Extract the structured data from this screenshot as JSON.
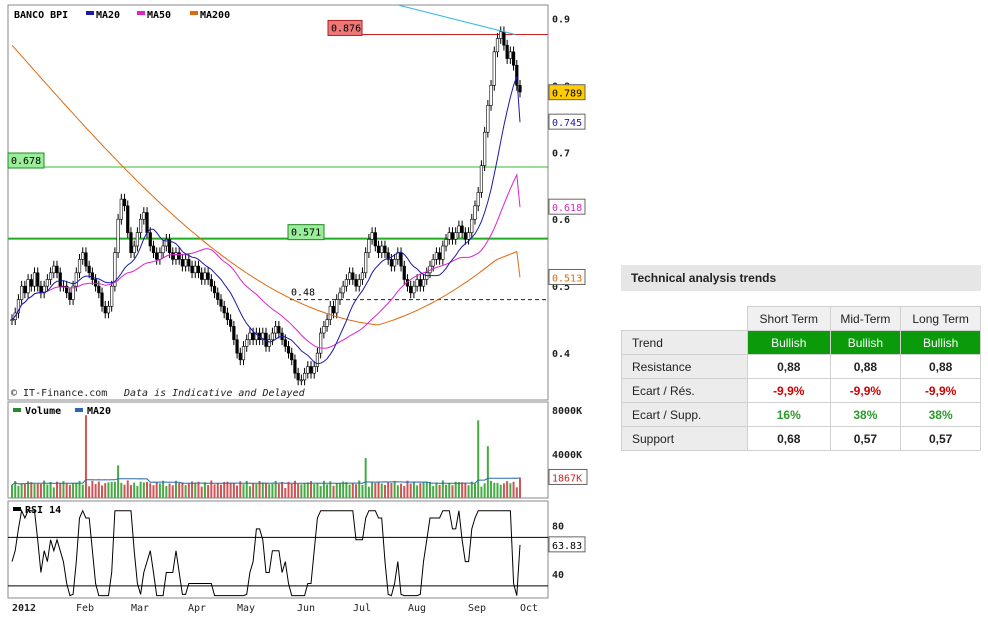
{
  "chart_data": [
    {
      "type": "candlestick",
      "title": "BANCO BPI",
      "legend": [
        {
          "name": "MA20",
          "color": "#1a1aaa"
        },
        {
          "name": "MA50",
          "color": "#dd22cc"
        },
        {
          "name": "MA200",
          "color": "#dd6a10"
        }
      ],
      "ylim": [
        0.33,
        0.92
      ],
      "y_ticks": [
        0.4,
        0.5,
        0.6,
        0.7,
        0.8,
        0.9
      ],
      "y_tick_labels": [
        "0.4",
        "0.5",
        "0.6",
        "0.7",
        "0.8",
        "0.9"
      ],
      "x_labels": [
        "2012",
        "Feb",
        "Mar",
        "Apr",
        "May",
        "Jun",
        "Jul",
        "Aug",
        "Sep",
        "Oct"
      ],
      "price_series": [
        0.45,
        0.46,
        0.48,
        0.5,
        0.49,
        0.51,
        0.5,
        0.52,
        0.5,
        0.49,
        0.5,
        0.51,
        0.52,
        0.53,
        0.52,
        0.5,
        0.5,
        0.49,
        0.48,
        0.5,
        0.52,
        0.54,
        0.55,
        0.53,
        0.52,
        0.51,
        0.5,
        0.49,
        0.47,
        0.46,
        0.47,
        0.5,
        0.55,
        0.6,
        0.63,
        0.62,
        0.58,
        0.55,
        0.56,
        0.58,
        0.6,
        0.61,
        0.58,
        0.56,
        0.55,
        0.54,
        0.55,
        0.56,
        0.57,
        0.55,
        0.54,
        0.55,
        0.54,
        0.53,
        0.54,
        0.53,
        0.52,
        0.53,
        0.52,
        0.51,
        0.52,
        0.51,
        0.5,
        0.49,
        0.48,
        0.47,
        0.46,
        0.45,
        0.44,
        0.42,
        0.4,
        0.39,
        0.41,
        0.42,
        0.43,
        0.42,
        0.43,
        0.42,
        0.43,
        0.41,
        0.42,
        0.43,
        0.44,
        0.43,
        0.42,
        0.41,
        0.4,
        0.39,
        0.37,
        0.36,
        0.36,
        0.37,
        0.38,
        0.37,
        0.38,
        0.4,
        0.43,
        0.44,
        0.45,
        0.47,
        0.46,
        0.48,
        0.49,
        0.5,
        0.51,
        0.52,
        0.51,
        0.5,
        0.51,
        0.52,
        0.55,
        0.57,
        0.58,
        0.56,
        0.55,
        0.56,
        0.55,
        0.54,
        0.53,
        0.54,
        0.55,
        0.53,
        0.51,
        0.5,
        0.49,
        0.5,
        0.51,
        0.5,
        0.51,
        0.52,
        0.53,
        0.54,
        0.55,
        0.54,
        0.56,
        0.57,
        0.58,
        0.57,
        0.58,
        0.59,
        0.58,
        0.57,
        0.58,
        0.6,
        0.62,
        0.64,
        0.68,
        0.73,
        0.77,
        0.8,
        0.85,
        0.87,
        0.88,
        0.86,
        0.84,
        0.85,
        0.83,
        0.8,
        0.79
      ],
      "ma20_end": 0.745,
      "ma50_end": 0.618,
      "ma200_end": 0.513,
      "levels": [
        {
          "value": 0.876,
          "label": "0.876",
          "color": "#d42020",
          "style": "solid"
        },
        {
          "value": 0.678,
          "label": "0.678",
          "color": "#33bb33",
          "style": "solid"
        },
        {
          "value": 0.571,
          "label": "0.571",
          "color": "#22aa22",
          "style": "solid"
        },
        {
          "value": 0.48,
          "label": "0.48",
          "color": "#222222",
          "style": "dashed"
        }
      ],
      "price_tags": [
        {
          "value": 0.789,
          "label": "0.789",
          "bg": "#ffcc00",
          "fg": "#000000"
        },
        {
          "value": 0.745,
          "label": "0.745",
          "bg": "#ffffff",
          "fg": "#1a1aaa"
        },
        {
          "value": 0.618,
          "label": "0.618",
          "bg": "#ffffff",
          "fg": "#dd22cc"
        },
        {
          "value": 0.513,
          "label": "0.513",
          "bg": "#ffffff",
          "fg": "#dd6a10"
        }
      ],
      "credit": "© IT-Finance.com",
      "disclaimer": "Data is Indicative and Delayed"
    },
    {
      "type": "bar",
      "legend": [
        {
          "name": "Volume",
          "color": "#2a8a2a"
        },
        {
          "name": "MA20",
          "color": "#2a6aaa"
        }
      ],
      "ylim": [
        0,
        8000
      ],
      "y_tick_labels": [
        "8000K",
        "4000K"
      ],
      "y_ticks": [
        8000,
        4000
      ],
      "last_value_label": "1867K",
      "last_value": 1867
    },
    {
      "type": "line",
      "legend": [
        {
          "name": "RSI 14",
          "color": "#000000"
        }
      ],
      "ylim": [
        20,
        100
      ],
      "y_ticks": [
        80,
        40
      ],
      "y_tick_labels": [
        "80",
        "40"
      ],
      "levels": [
        70,
        30
      ],
      "last_value_label": "63.83",
      "last_value": 63.83
    }
  ],
  "trends": {
    "title": "Technical analysis trends",
    "columns": [
      "Short Term",
      "Mid-Term",
      "Long Term"
    ],
    "rows": [
      {
        "label": "Trend",
        "values": [
          "Bullish",
          "Bullish",
          "Bullish"
        ],
        "style": "bull"
      },
      {
        "label": "Resistance",
        "values": [
          "0,88",
          "0,88",
          "0,88"
        ],
        "style": "plain"
      },
      {
        "label": "Ecart / Rés.",
        "values": [
          "-9,9%",
          "-9,9%",
          "-9,9%"
        ],
        "style": "neg"
      },
      {
        "label": "Ecart / Supp.",
        "values": [
          "16%",
          "38%",
          "38%"
        ],
        "style": "pos"
      },
      {
        "label": "Support",
        "values": [
          "0,68",
          "0,57",
          "0,57"
        ],
        "style": "plain"
      }
    ]
  }
}
